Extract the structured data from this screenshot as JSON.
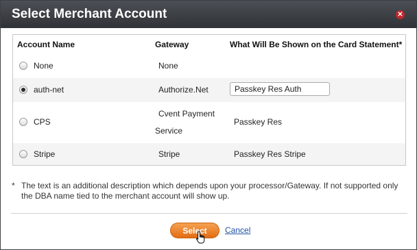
{
  "dialog": {
    "title": "Select Merchant Account",
    "close_icon": "close-icon"
  },
  "table": {
    "headers": {
      "account_name": "Account Name",
      "gateway": "Gateway",
      "statement": "What Will Be Shown on the Card Statement*"
    },
    "rows": [
      {
        "account": "None",
        "gateway": "None",
        "statement": "",
        "selected": false
      },
      {
        "account": "auth-net",
        "gateway": "Authorize.Net",
        "statement": "Passkey Res Auth",
        "selected": true
      },
      {
        "account": "CPS",
        "gateway_line1": "Cvent Payment",
        "gateway_line2": "Service",
        "statement": "Passkey Res",
        "selected": false
      },
      {
        "account": "Stripe",
        "gateway": "Stripe",
        "statement": "Passkey Res Stripe",
        "selected": false
      }
    ]
  },
  "note": {
    "asterisk": "*",
    "text": "The text is an additional description which depends upon your processor/Gateway. If not supported only the DBA name tied to the merchant account will show up."
  },
  "actions": {
    "select_label": "Select",
    "cancel_label": "Cancel"
  },
  "colors": {
    "title_bar": "#3a3d42",
    "select_button": "#e8771a",
    "link": "#1f4fa6"
  }
}
